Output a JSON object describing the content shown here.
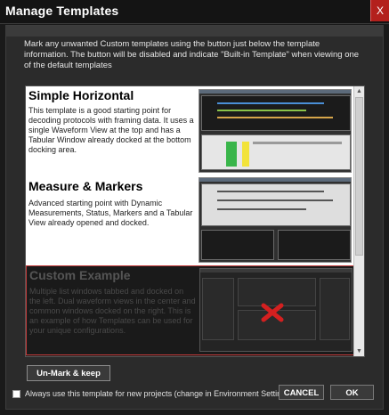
{
  "window": {
    "title": "Manage Templates",
    "close_label": "X"
  },
  "instructions": "Mark any unwanted Custom templates using the button just below the template information. The button will be disabled and indicate \"Built-in Template\" when viewing one of the default templates",
  "templates": [
    {
      "title": "Simple Horizontal",
      "description": "This template is a good starting point for decoding protocols with framing data. It uses a single Waveform View at the top and has a Tabular Window already docked at the bottom docking area.",
      "marked": false
    },
    {
      "title": "Measure & Markers",
      "description": "Advanced starting point with Dynamic Measurements, Status, Markers and a Tabular View already opened and docked.",
      "marked": false
    },
    {
      "title": "Custom Example",
      "description": "Multiple list windows tabbed and docked on the left. Dual waveform views in the center and common windows docked on the right. This is an example of how Templates can be used for your unique configurations.",
      "marked": true
    }
  ],
  "buttons": {
    "unmark": "Un-Mark & keep",
    "cancel": "CANCEL",
    "ok": "OK"
  },
  "checkbox": {
    "label": "Always use this template for new projects (change in Environment Settings)",
    "checked": false
  },
  "colors": {
    "close_button": "#b3201c",
    "selected_border": "#c23a3a",
    "mark_x": "#d42020"
  },
  "icons": {
    "scroll_up": "chevron-up-icon",
    "scroll_down": "chevron-down-icon",
    "mark": "red-x-icon"
  }
}
